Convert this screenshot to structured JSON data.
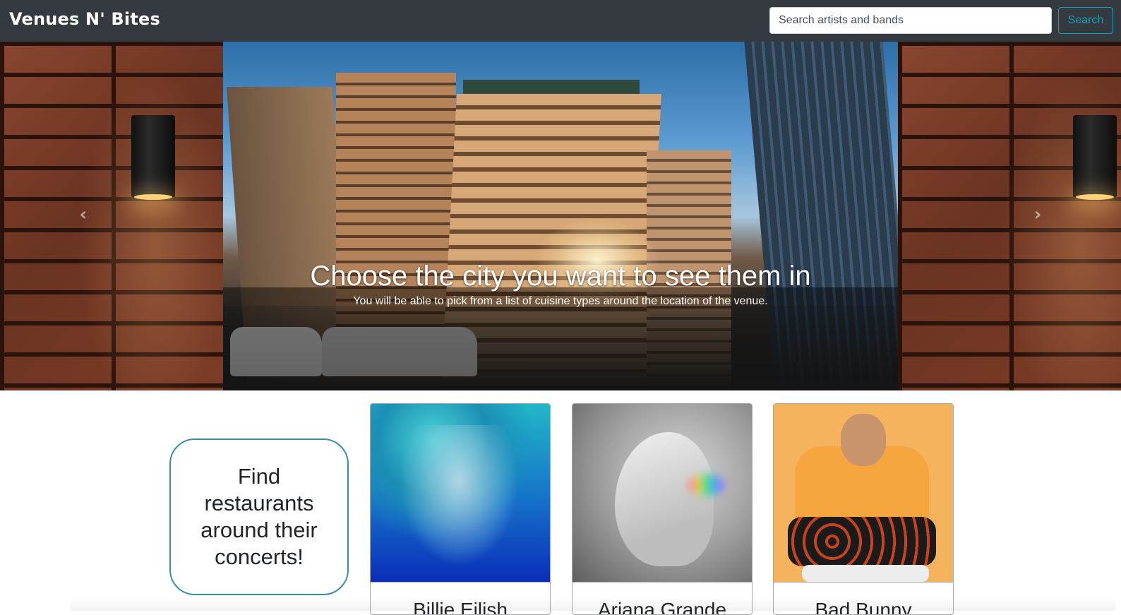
{
  "navbar": {
    "brand": "Venues N' Bites",
    "search_placeholder": "Search artists and bands",
    "search_button": "Search"
  },
  "carousel": {
    "title": "Choose the city you want to see them in",
    "text": "You will be able to pick from a list of cuisine types around the location of the venue.",
    "prev_icon": "chevron-left-icon",
    "next_icon": "chevron-right-icon",
    "prev_glyph": "‹",
    "next_glyph": "›"
  },
  "tagline": "Find restaurants around their concerts!",
  "artists": [
    {
      "name": "Billie Eilish"
    },
    {
      "name": "Ariana Grande"
    },
    {
      "name": "Bad Bunny"
    }
  ],
  "colors": {
    "navbar_bg": "#343a40",
    "accent": "#17a2b8",
    "tagline_border": "#3a8ea3"
  }
}
